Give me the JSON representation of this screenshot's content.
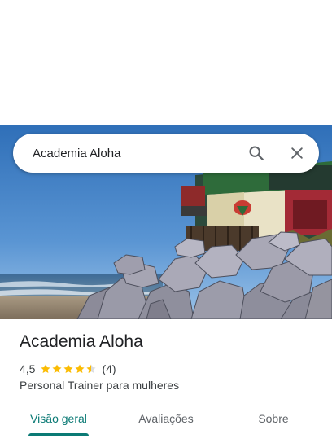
{
  "search": {
    "query": "Academia Aloha",
    "search_icon": "search-icon",
    "close_icon": "close-icon"
  },
  "hero": {
    "description_icon": "place-photo"
  },
  "place": {
    "name": "Academia Aloha",
    "rating": "4,5",
    "stars": 4.5,
    "review_count": "(4)",
    "category": "Personal Trainer para mulheres"
  },
  "tabs": [
    {
      "label": "Visão geral",
      "active": true
    },
    {
      "label": "Avaliações",
      "active": false
    },
    {
      "label": "Sobre",
      "active": false
    }
  ],
  "colors": {
    "accent": "#0b7a75",
    "star": "#fbbc04",
    "star_empty": "#dadce0",
    "text_primary": "#202124",
    "text_secondary": "#3c4043"
  }
}
